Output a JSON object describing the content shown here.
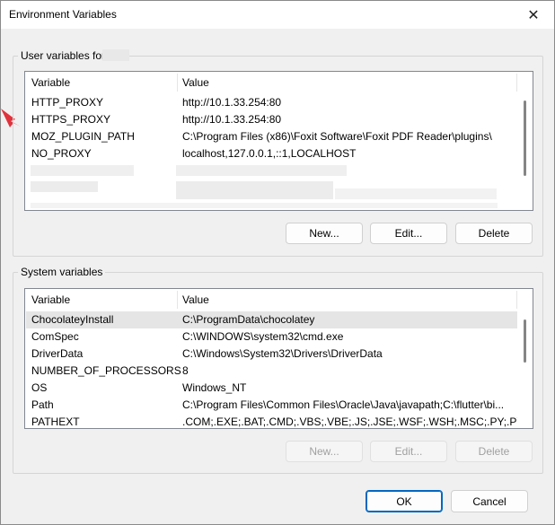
{
  "window": {
    "title": "Environment Variables",
    "close_glyph": "✕"
  },
  "user_group": {
    "label": "User variables for",
    "columns": [
      "Variable",
      "Value"
    ],
    "rows": [
      {
        "variable": "HTTP_PROXY",
        "value": "http://10.1.33.254:80"
      },
      {
        "variable": "HTTPS_PROXY",
        "value": "http://10.1.33.254:80"
      },
      {
        "variable": "MOZ_PLUGIN_PATH",
        "value": "C:\\Program Files (x86)\\Foxit Software\\Foxit PDF Reader\\plugins\\"
      },
      {
        "variable": "NO_PROXY",
        "value": "localhost,127.0.0.1,::1,LOCALHOST"
      }
    ],
    "buttons": {
      "new": "New...",
      "edit": "Edit...",
      "delete": "Delete"
    }
  },
  "system_group": {
    "label": "System variables",
    "columns": [
      "Variable",
      "Value"
    ],
    "rows": [
      {
        "variable": "ChocolateyInstall",
        "value": "C:\\ProgramData\\chocolatey"
      },
      {
        "variable": "ComSpec",
        "value": "C:\\WINDOWS\\system32\\cmd.exe"
      },
      {
        "variable": "DriverData",
        "value": "C:\\Windows\\System32\\Drivers\\DriverData"
      },
      {
        "variable": "NUMBER_OF_PROCESSORS",
        "value": "8"
      },
      {
        "variable": "OS",
        "value": "Windows_NT"
      },
      {
        "variable": "Path",
        "value": "C:\\Program Files\\Common Files\\Oracle\\Java\\javapath;C:\\flutter\\bi..."
      },
      {
        "variable": "PATHEXT",
        "value": ".COM;.EXE;.BAT;.CMD;.VBS;.VBE;.JS;.JSE;.WSF;.WSH;.MSC;.PY;.PYW"
      }
    ],
    "buttons": {
      "new": "New...",
      "edit": "Edit...",
      "delete": "Delete"
    }
  },
  "footer": {
    "ok": "OK",
    "cancel": "Cancel"
  },
  "colors": {
    "arrow": "#e0323c",
    "accent": "#0067c0"
  }
}
